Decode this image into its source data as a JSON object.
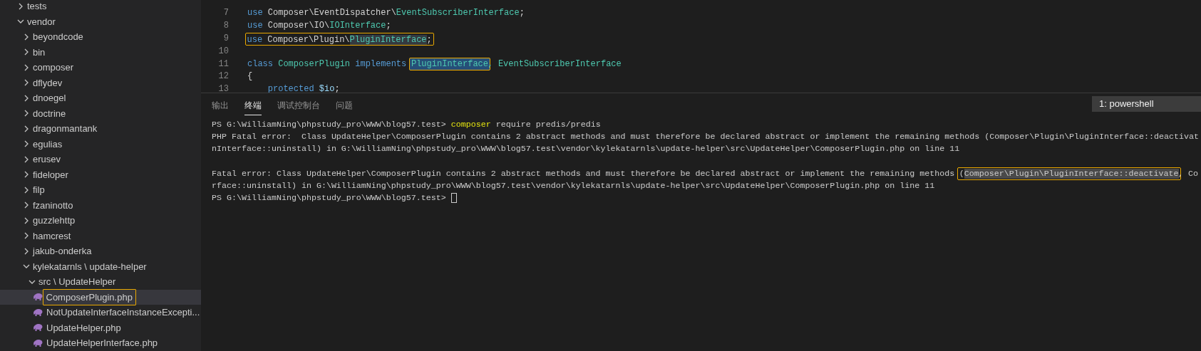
{
  "explorer": {
    "items": [
      {
        "kind": "folder",
        "label": "tests",
        "expanded": false,
        "selected": false
      },
      {
        "kind": "folder",
        "label": "vendor",
        "expanded": true,
        "selected": false,
        "children": [
          {
            "kind": "folder",
            "label": "beyondcode",
            "expanded": false,
            "selected": false
          },
          {
            "kind": "folder",
            "label": "bin",
            "expanded": false,
            "selected": false
          },
          {
            "kind": "folder",
            "label": "composer",
            "expanded": false,
            "selected": false
          },
          {
            "kind": "folder",
            "label": "dflydev",
            "expanded": false,
            "selected": false
          },
          {
            "kind": "folder",
            "label": "dnoegel",
            "expanded": false,
            "selected": false
          },
          {
            "kind": "folder",
            "label": "doctrine",
            "expanded": false,
            "selected": false
          },
          {
            "kind": "folder",
            "label": "dragonmantank",
            "expanded": false,
            "selected": false
          },
          {
            "kind": "folder",
            "label": "egulias",
            "expanded": false,
            "selected": false
          },
          {
            "kind": "folder",
            "label": "erusev",
            "expanded": false,
            "selected": false
          },
          {
            "kind": "folder",
            "label": "fideloper",
            "expanded": false,
            "selected": false
          },
          {
            "kind": "folder",
            "label": "filp",
            "expanded": false,
            "selected": false
          },
          {
            "kind": "folder",
            "label": "fzaninotto",
            "expanded": false,
            "selected": false
          },
          {
            "kind": "folder",
            "label": "guzzlehttp",
            "expanded": false,
            "selected": false
          },
          {
            "kind": "folder",
            "label": "hamcrest",
            "expanded": false,
            "selected": false
          },
          {
            "kind": "folder",
            "label": "jakub-onderka",
            "expanded": false,
            "selected": false
          },
          {
            "kind": "folder",
            "label": "kylekatarnls \\ update-helper",
            "expanded": true,
            "selected": false,
            "children": [
              {
                "kind": "folder",
                "label": "src \\ UpdateHelper",
                "expanded": true,
                "selected": false,
                "children": [
                  {
                    "kind": "file",
                    "label": "ComposerPlugin.php",
                    "selected": true,
                    "boxed": true
                  },
                  {
                    "kind": "file",
                    "label": "NotUpdateInterfaceInstanceExcepti...",
                    "selected": false
                  },
                  {
                    "kind": "file",
                    "label": "UpdateHelper.php",
                    "selected": false
                  },
                  {
                    "kind": "file",
                    "label": "UpdateHelperInterface.php",
                    "selected": false
                  }
                ]
              }
            ]
          }
        ]
      }
    ]
  },
  "editor": {
    "lines": [
      {
        "number": "7",
        "tokens": [
          {
            "text": "use",
            "kind": "keyword"
          },
          {
            "text": " Composer\\EventDispatcher\\",
            "kind": "plain"
          },
          {
            "text": "EventSubscriberInterface",
            "kind": "type"
          },
          {
            "text": ";",
            "kind": "plain"
          }
        ]
      },
      {
        "number": "8",
        "tokens": [
          {
            "text": "use",
            "kind": "keyword"
          },
          {
            "text": " Composer\\IO\\",
            "kind": "plain"
          },
          {
            "text": "IOInterface",
            "kind": "type"
          },
          {
            "text": ";",
            "kind": "plain"
          }
        ]
      },
      {
        "number": "9",
        "boxed": true,
        "tokens": [
          {
            "text": "use",
            "kind": "keyword"
          },
          {
            "text": " Composer\\Plugin\\",
            "kind": "plain"
          },
          {
            "text": "PluginInterface",
            "kind": "type",
            "matched": true
          },
          {
            "text": ";",
            "kind": "plain"
          }
        ]
      },
      {
        "number": "10"
      },
      {
        "number": "11",
        "tokens": [
          {
            "text": "class",
            "kind": "keyword"
          },
          {
            "text": " ComposerPlugin",
            "kind": "type"
          },
          {
            "text": " implements ",
            "kind": "keyword"
          },
          {
            "text": "PluginInterface",
            "kind": "type",
            "selected": true,
            "boxed": true
          },
          {
            "text": ", EventSubscriberInterface",
            "kind": "type"
          }
        ]
      },
      {
        "number": "12",
        "tokens": [
          {
            "text": "{",
            "kind": "plain"
          }
        ]
      },
      {
        "number": "13",
        "tokens": [
          {
            "text": "    protected",
            "kind": "keyword"
          },
          {
            "text": " $io",
            "kind": "variable"
          },
          {
            "text": ";",
            "kind": "plain"
          }
        ]
      }
    ]
  },
  "panel": {
    "tabs": [
      {
        "label": "输出",
        "selected": false
      },
      {
        "label": "终端",
        "selected": true
      },
      {
        "label": "调试控制台",
        "selected": false
      },
      {
        "label": "问题",
        "selected": false
      }
    ],
    "terminal_select": "1: powershell",
    "terminal": [
      {
        "segments": [
          {
            "text": "PS G:\\WilliamNing\\phpstudy_pro\\WWW\\blog57.test> ",
            "kind": "plain"
          },
          {
            "text": "composer",
            "kind": "command"
          },
          {
            "text": " require predis/predis",
            "kind": "plain"
          }
        ]
      },
      {
        "segments": [
          {
            "text": "PHP Fatal error:  Class UpdateHelper\\ComposerPlugin contains 2 abstract methods and must therefore be declared abstract or implement the remaining methods (Composer\\Plugin\\PluginInterface::deactivat",
            "kind": "plain"
          }
        ]
      },
      {
        "segments": [
          {
            "text": "nInterface::uninstall) in G:\\WilliamNing\\phpstudy_pro\\WWW\\blog57.test\\vendor\\kylekatarnls\\update-helper\\src\\UpdateHelper\\ComposerPlugin.php on line 11",
            "kind": "plain"
          }
        ]
      },
      {
        "spaced": true,
        "segments": [
          {
            "text": "Fatal error: Class UpdateHelper\\ComposerPlugin contains 2 abstract methods and must therefore be declared abstract or implement the remaining methods ",
            "kind": "plain"
          },
          {
            "kind": "boxed",
            "parts": [
              {
                "text": "(",
                "kind": "plain"
              },
              {
                "text": "Composer\\Plugin\\PluginInterface::deactivate",
                "kind": "selection"
              }
            ]
          },
          {
            "text": ", Co",
            "kind": "plain"
          }
        ]
      },
      {
        "segments": [
          {
            "text": "rface::uninstall) in G:\\WilliamNing\\phpstudy_pro\\WWW\\blog57.test\\vendor\\kylekatarnls\\update-helper\\src\\UpdateHelper\\ComposerPlugin.php on line 11",
            "kind": "plain"
          }
        ]
      },
      {
        "segments": [
          {
            "text": "PS G:\\WilliamNing\\phpstudy_pro\\WWW\\blog57.test> ",
            "kind": "plain"
          }
        ],
        "cursor": true
      }
    ]
  }
}
